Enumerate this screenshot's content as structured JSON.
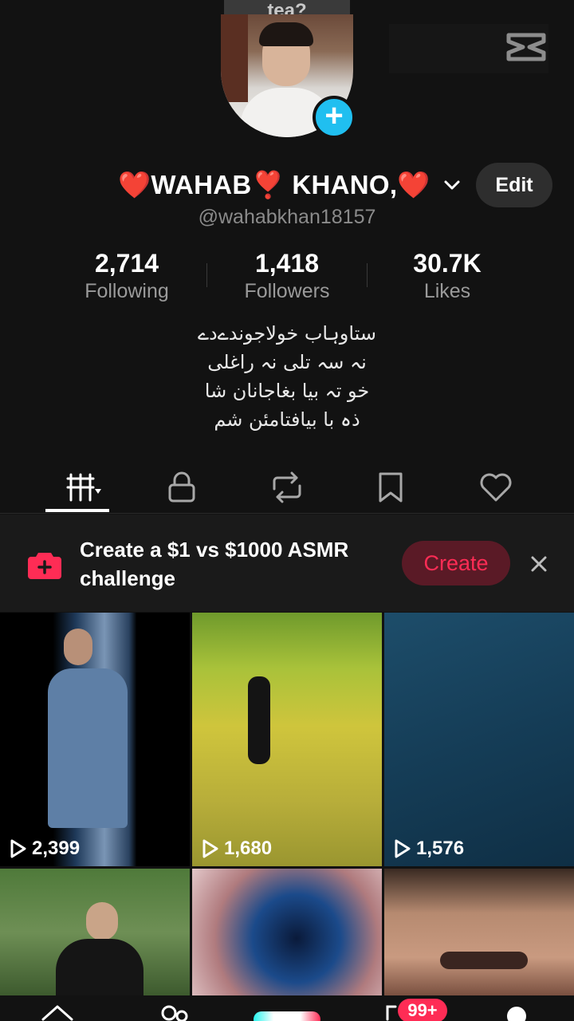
{
  "top_pill": {
    "text": "tea?"
  },
  "profile": {
    "display_name": "❤️WAHAB❣️ KHANO,❤️",
    "handle": "@wahabkhan18157",
    "edit_label": "Edit",
    "stats": [
      {
        "value": "2,714",
        "label": "Following"
      },
      {
        "value": "1,418",
        "label": "Followers"
      },
      {
        "value": "30.7K",
        "label": "Likes"
      }
    ],
    "bio_lines": [
      "ستاوہاب خولاجوندےدے",
      "نہ سہ تلی نہ راغلی",
      "خو تہ بیا بغاجانان شا",
      "ذہ با بیافتامئن شم"
    ]
  },
  "tabs": [
    {
      "icon": "videos-grid-icon"
    },
    {
      "icon": "lock-icon"
    },
    {
      "icon": "repost-icon"
    },
    {
      "icon": "bookmark-icon"
    },
    {
      "icon": "heart-icon"
    }
  ],
  "promo": {
    "text": "Create a $1 vs $1000 ASMR challenge",
    "button_label": "Create"
  },
  "videos": [
    {
      "views": "2,399"
    },
    {
      "views": "1,680"
    },
    {
      "views": "1,576"
    },
    {
      "views": ""
    },
    {
      "views": ""
    },
    {
      "views": ""
    }
  ],
  "nav": {
    "inbox_badge": "99+"
  },
  "colors": {
    "accent": "#fe2c55",
    "badge_blue": "#20bff0",
    "background": "#121212"
  }
}
